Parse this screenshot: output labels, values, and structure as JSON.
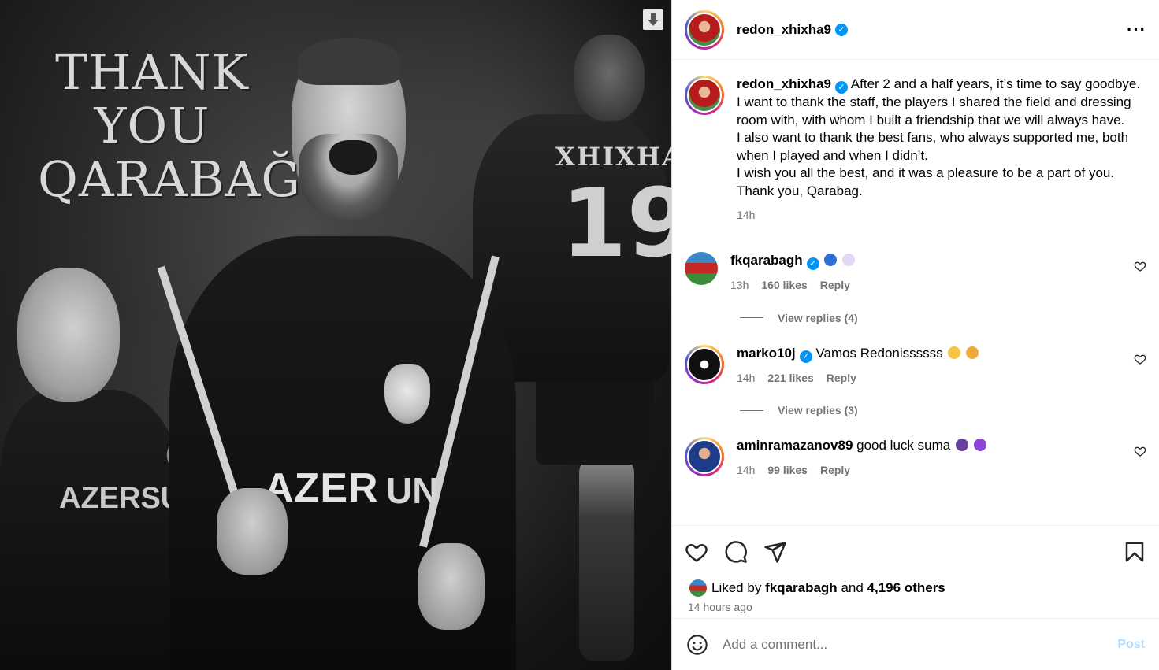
{
  "media": {
    "headline_line1": "THANK YOU",
    "headline_line2": "QARABAĞ",
    "shirt_name": "XHIXHA",
    "shirt_number": "19",
    "sponsor_main": "AZER",
    "sponsor_main2": "UN",
    "sponsor_left": "AZERSU"
  },
  "post": {
    "author": "redon_xhixha9",
    "caption_lines": [
      "After 2 and a half years, it’s time to say goodbye.",
      "I want to thank the staff, the players I shared the field and dressing room with, with whom I built a friendship that we will always have.",
      "I also want to thank the best fans, who always supported me, both when I played and when I didn’t.",
      "I wish you all the best, and it was a pleasure to be a part of you.",
      "Thank you, Qarabag."
    ],
    "caption_time": "14h"
  },
  "comments": [
    {
      "user": "fkqarabagh",
      "text": "",
      "emojis": [
        "#2f6fd6",
        "#e4d7f5"
      ],
      "time": "13h",
      "likes": "160 likes",
      "reply": "Reply",
      "view_replies": "View replies (4)"
    },
    {
      "user": "marko10j",
      "text": "Vamos Redonissssss",
      "emojis": [
        "#f5c542",
        "#f2a93b"
      ],
      "time": "14h",
      "likes": "221 likes",
      "reply": "Reply",
      "view_replies": "View replies (3)"
    },
    {
      "user": "aminramazanov89",
      "text": "good luck suma",
      "emojis": [
        "#6a3fa0",
        "#8e44d6"
      ],
      "time": "14h",
      "likes": "99 likes",
      "reply": "Reply"
    }
  ],
  "liked_by": {
    "prefix": "Liked by",
    "user": "fkqarabagh",
    "and": "and",
    "others": "4,196 others"
  },
  "posted_ago": "14 hours ago",
  "add_comment": {
    "placeholder": "Add a comment...",
    "post_label": "Post"
  },
  "colors": {
    "verified": "#0095f6",
    "muted": "#737373",
    "post_disabled": "#b3dbff"
  }
}
